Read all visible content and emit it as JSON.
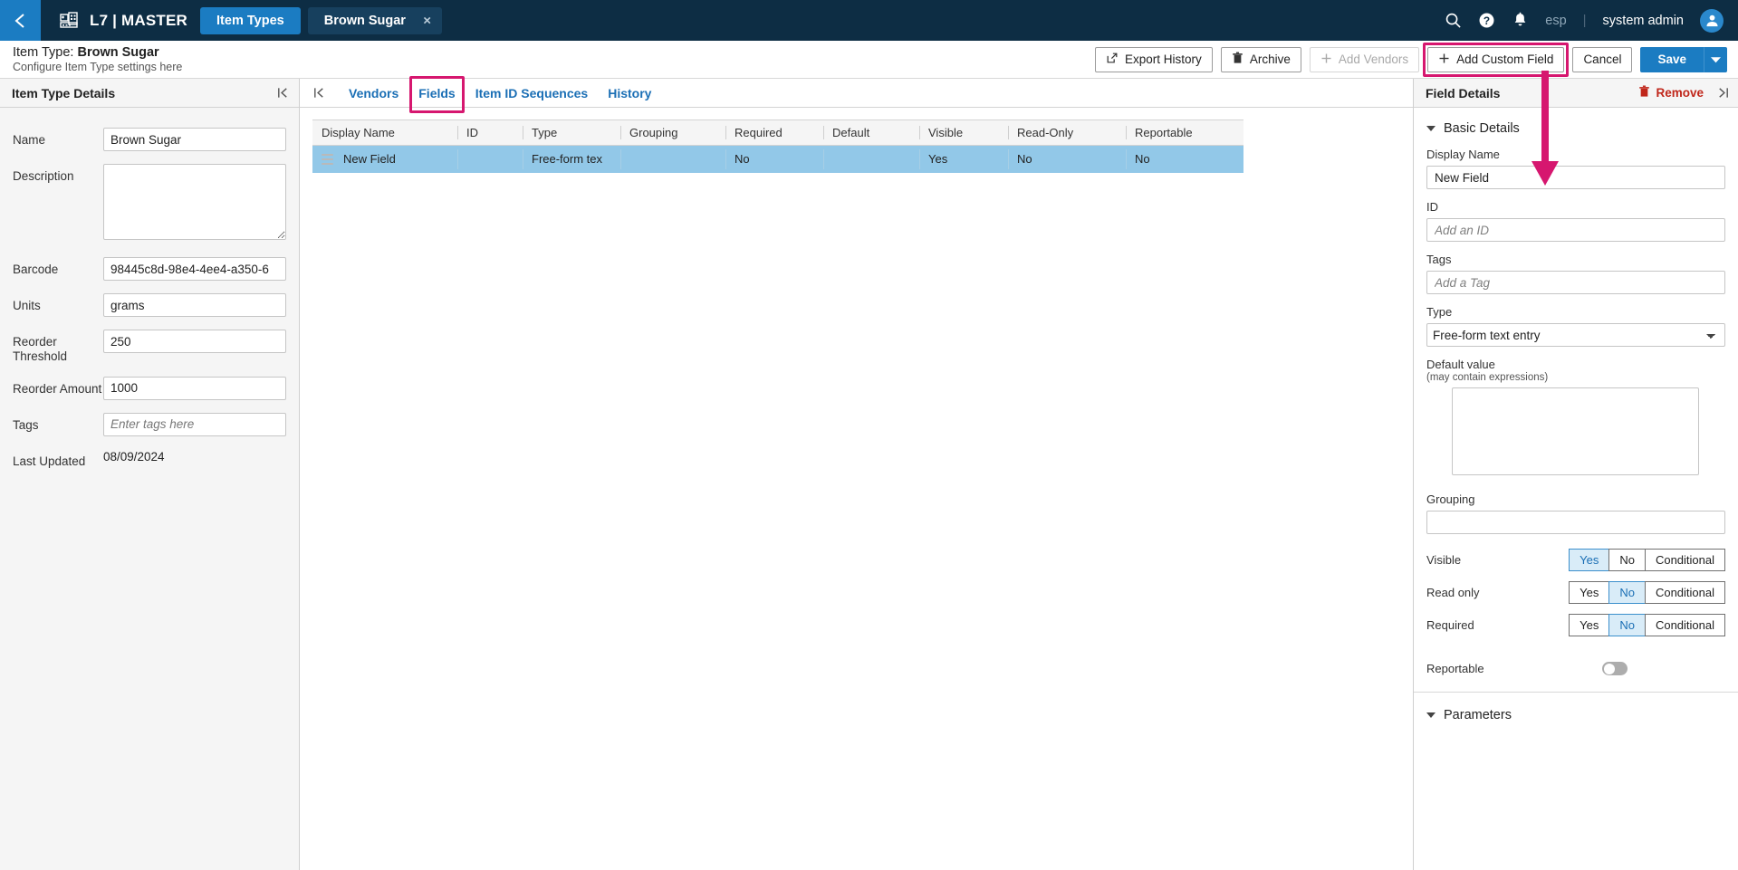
{
  "topnav": {
    "back_icon": "chevron-left-icon",
    "app_logo_icon": "building-grid-icon",
    "app_name": "L7 | MASTER",
    "tabs": [
      {
        "label": "Item Types",
        "active": true
      },
      {
        "label": "Brown Sugar",
        "active": false,
        "closable": true
      }
    ],
    "close_glyph": "×",
    "icons": [
      "search-icon",
      "help-icon",
      "notifications-bell-icon"
    ],
    "language": "esp",
    "separator": "|",
    "user": "system admin",
    "avatar_icon": "user-avatar-icon"
  },
  "page_header": {
    "title_prefix": "Item Type: ",
    "title_value": "Brown Sugar",
    "subtitle": "Configure Item Type settings here",
    "buttons": {
      "export_history": "Export History",
      "archive": "Archive",
      "add_vendors": "Add Vendors",
      "add_custom_field": "Add Custom Field",
      "cancel": "Cancel",
      "save": "Save"
    }
  },
  "left_panel": {
    "title": "Item Type Details",
    "collapse_icon": "collapse-left-icon",
    "fields": {
      "name_label": "Name",
      "name_value": "Brown Sugar",
      "description_label": "Description",
      "description_value": "",
      "barcode_label": "Barcode",
      "barcode_value": "98445c8d-98e4-4ee4-a350-6",
      "units_label": "Units",
      "units_value": "grams",
      "reorder_threshold_label": "Reorder Threshold",
      "reorder_threshold_value": "250",
      "reorder_amount_label": "Reorder Amount",
      "reorder_amount_value": "1000",
      "tags_label": "Tags",
      "tags_placeholder": "Enter tags here",
      "tags_value": "",
      "last_updated_label": "Last Updated",
      "last_updated_value": "08/09/2024"
    }
  },
  "center_panel": {
    "collapse_icon": "collapse-left-icon",
    "tabs": [
      {
        "label": "Vendors",
        "highlighted": false
      },
      {
        "label": "Fields",
        "highlighted": true
      },
      {
        "label": "Item ID Sequences",
        "highlighted": false
      },
      {
        "label": "History",
        "highlighted": false
      }
    ],
    "table": {
      "columns": [
        "Display Name",
        "ID",
        "Type",
        "Grouping",
        "Required",
        "Default",
        "Visible",
        "Read-Only",
        "Reportable"
      ],
      "rows": [
        {
          "display_name": "New Field",
          "id": "",
          "type": "Free-form tex",
          "grouping": "",
          "required": "No",
          "default": "",
          "visible": "Yes",
          "read_only": "No",
          "reportable": "No",
          "selected": true
        }
      ]
    }
  },
  "right_panel": {
    "title": "Field Details",
    "remove_label": "Remove",
    "remove_icon": "trash-icon",
    "collapse_icon": "collapse-right-icon",
    "basic_details_label": "Basic Details",
    "display_name_label": "Display Name",
    "display_name_value": "New Field",
    "id_label": "ID",
    "id_placeholder": "Add an ID",
    "id_value": "",
    "tags_label": "Tags",
    "tags_placeholder": "Add a Tag",
    "tags_value": "",
    "type_label": "Type",
    "type_value": "Free-form text entry",
    "type_options": [
      "Free-form text entry"
    ],
    "default_value_label": "Default value",
    "default_value_sub": "(may contain expressions)",
    "default_value": "",
    "grouping_label": "Grouping",
    "grouping_value": "",
    "visible_label": "Visible",
    "visible_options": [
      "Yes",
      "No",
      "Conditional"
    ],
    "visible_selected": "Yes",
    "read_only_label": "Read only",
    "read_only_options": [
      "Yes",
      "No",
      "Conditional"
    ],
    "read_only_selected": "No",
    "required_label": "Required",
    "required_options": [
      "Yes",
      "No",
      "Conditional"
    ],
    "required_selected": "No",
    "reportable_label": "Reportable",
    "reportable_on": false,
    "parameters_label": "Parameters"
  },
  "colors": {
    "nav_bg": "#0d2d44",
    "accent_blue": "#1b7cc2",
    "link_blue": "#1b6fb5",
    "annotation_magenta": "#d6176f",
    "row_selected": "#92c8e8",
    "remove_red": "#c0261a"
  }
}
